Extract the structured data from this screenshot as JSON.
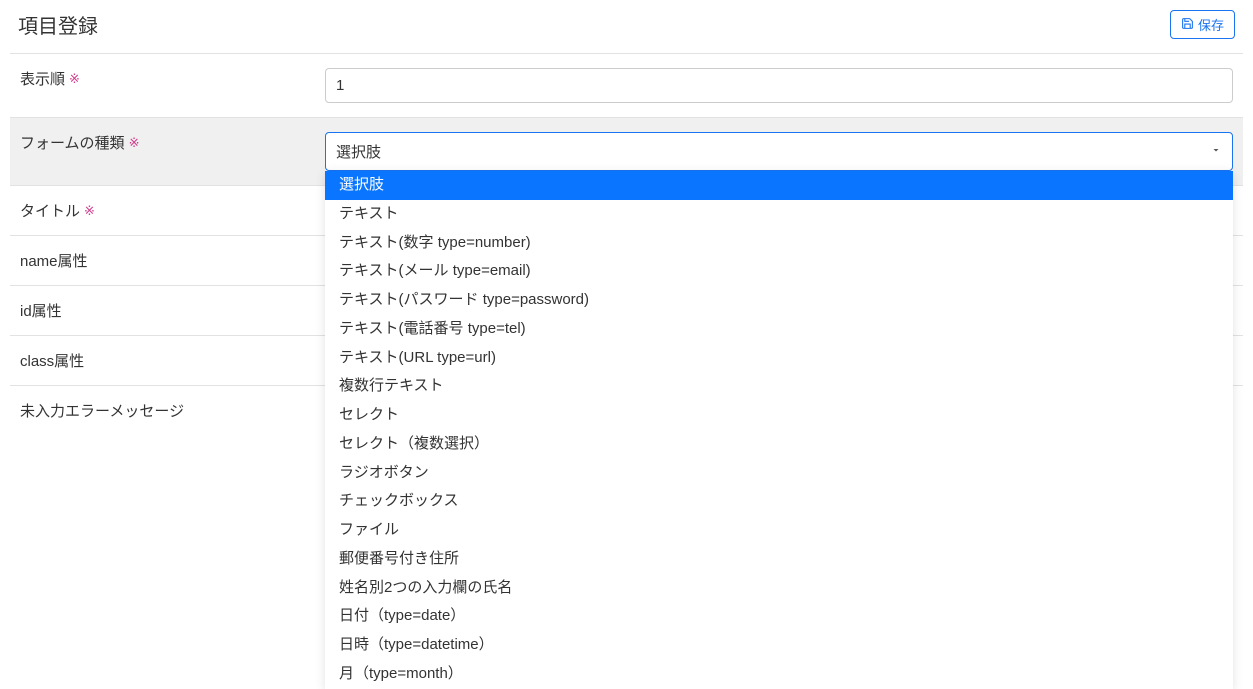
{
  "header": {
    "title": "項目登録",
    "save_label": "保存"
  },
  "rows": {
    "order": {
      "label": "表示順",
      "required": true,
      "value": "1"
    },
    "form_type": {
      "label": "フォームの種類",
      "required": true,
      "selected": "選択肢"
    },
    "title": {
      "label": "タイトル",
      "required": true
    },
    "name_attr": {
      "label": "name属性",
      "required": false
    },
    "id_attr": {
      "label": "id属性",
      "required": false
    },
    "class_attr": {
      "label": "class属性",
      "required": false
    },
    "blank_error": {
      "label": "未入力エラーメッセージ",
      "required": false
    }
  },
  "form_type_options": [
    "選択肢",
    "テキスト",
    "テキスト(数字 type=number)",
    "テキスト(メール type=email)",
    "テキスト(パスワード type=password)",
    "テキスト(電話番号 type=tel)",
    "テキスト(URL type=url)",
    "複数行テキスト",
    "セレクト",
    "セレクト（複数選択）",
    "ラジオボタン",
    "チェックボックス",
    "ファイル",
    "郵便番号付き住所",
    "姓名別2つの入力欄の氏名",
    "日付（type=date）",
    "日時（type=datetime）",
    "月（type=month）"
  ],
  "required_marker": "※"
}
